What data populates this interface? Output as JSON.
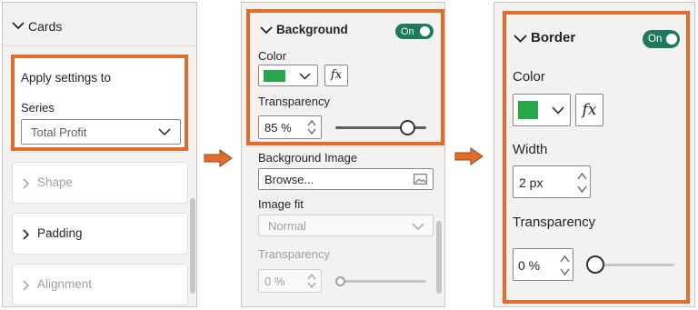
{
  "panel1": {
    "cards_label": "Cards",
    "apply_settings_label": "Apply settings to",
    "series_label": "Series",
    "series_value": "Total Profit",
    "shape_label": "Shape",
    "padding_label": "Padding",
    "alignment_label": "Alignment"
  },
  "panel2": {
    "background_label": "Background",
    "toggle_label": "On",
    "color_label": "Color",
    "color_value": "#26a84a",
    "fx_label": "fx",
    "transparency_label": "Transparency",
    "transparency_value": "85 %",
    "transparency_level": 0.85,
    "background_image_label": "Background Image",
    "browse_label": "Browse...",
    "image_fit_label": "Image fit",
    "image_fit_value": "Normal",
    "transparency2_label": "Transparency",
    "transparency2_value": "0 %",
    "transparency2_level": 0
  },
  "panel3": {
    "border_label": "Border",
    "toggle_label": "On",
    "color_label": "Color",
    "color_value": "#26a84a",
    "fx_label": "fx",
    "width_label": "Width",
    "width_value": "2 px",
    "transparency_label": "Transparency",
    "transparency_value": "0 %",
    "transparency_level": 0
  },
  "colors": {
    "highlight": "#e46c2a",
    "toggle_on": "#1e7a5f",
    "swatch": "#26a84a"
  }
}
